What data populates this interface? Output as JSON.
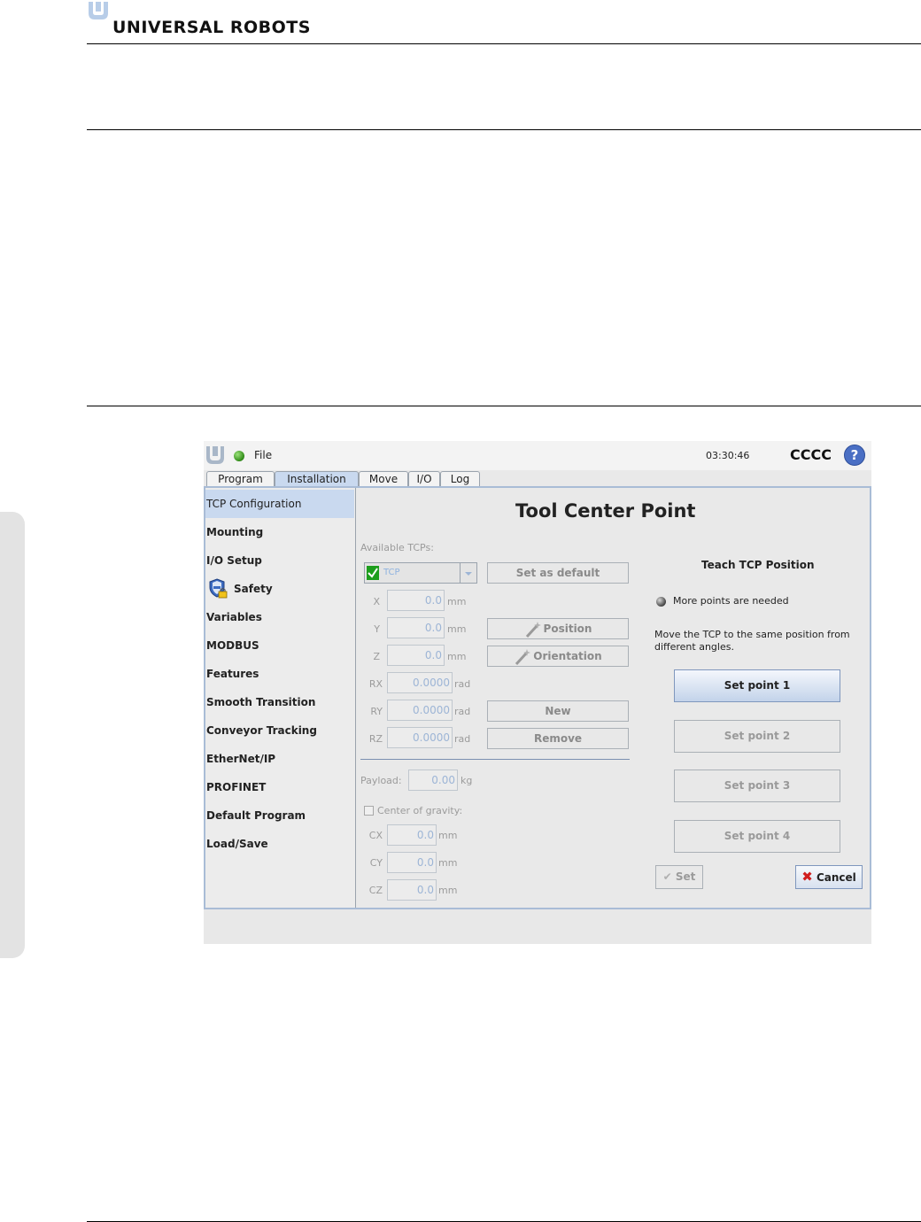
{
  "header": {
    "brand": "UNIVERSAL ROBOTS"
  },
  "app": {
    "menu_file": "File",
    "clock": "03:30:46",
    "robot_name": "CCCC",
    "help_symbol": "?",
    "tabs": [
      {
        "label": "Program"
      },
      {
        "label": "Installation",
        "active": true
      },
      {
        "label": "Move"
      },
      {
        "label": "I/O"
      },
      {
        "label": "Log"
      }
    ],
    "sidebar": {
      "items": [
        {
          "label": "TCP Configuration",
          "active": true
        },
        {
          "label": "Mounting"
        },
        {
          "label": "I/O Setup"
        },
        {
          "label": "Safety",
          "icon": "shield-lock-icon"
        },
        {
          "label": "Variables"
        },
        {
          "label": "MODBUS"
        },
        {
          "label": "Features"
        },
        {
          "label": "Smooth Transition"
        },
        {
          "label": "Conveyor Tracking"
        },
        {
          "label": "EtherNet/IP"
        },
        {
          "label": "PROFINET"
        },
        {
          "label": "Default Program"
        },
        {
          "label": "Load/Save"
        }
      ]
    },
    "tcp": {
      "title": "Tool Center Point",
      "available_label": "Available TCPs:",
      "selected_tcp": "TCP",
      "set_default_label": "Set as default",
      "position_label": "Position",
      "orientation_label": "Orientation",
      "new_label": "New",
      "remove_label": "Remove",
      "fields": {
        "x": {
          "label": "X",
          "value": "0.0",
          "unit": "mm"
        },
        "y": {
          "label": "Y",
          "value": "0.0",
          "unit": "mm"
        },
        "z": {
          "label": "Z",
          "value": "0.0",
          "unit": "mm"
        },
        "rx": {
          "label": "RX",
          "value": "0.0000",
          "unit": "rad"
        },
        "ry": {
          "label": "RY",
          "value": "0.0000",
          "unit": "rad"
        },
        "rz": {
          "label": "RZ",
          "value": "0.0000",
          "unit": "rad"
        }
      },
      "payload": {
        "label": "Payload:",
        "value": "0.00",
        "unit": "kg"
      },
      "cog": {
        "label": "Center of gravity:",
        "cx": {
          "label": "CX",
          "value": "0.0",
          "unit": "mm"
        },
        "cy": {
          "label": "CY",
          "value": "0.0",
          "unit": "mm"
        },
        "cz": {
          "label": "CZ",
          "value": "0.0",
          "unit": "mm"
        }
      }
    },
    "teach": {
      "title": "Teach TCP Position",
      "status": "More points are needed",
      "instruction": "Move the TCP to the same position from different angles.",
      "points": [
        "Set point 1",
        "Set point 2",
        "Set point 3",
        "Set point 4"
      ],
      "set_label": "Set",
      "cancel_label": "Cancel"
    }
  },
  "colors": {
    "accent": "#c9d9ef",
    "status_ok": "#2f8a17",
    "help": "#4a6fc4",
    "cancel_icon": "#d01e1e"
  }
}
